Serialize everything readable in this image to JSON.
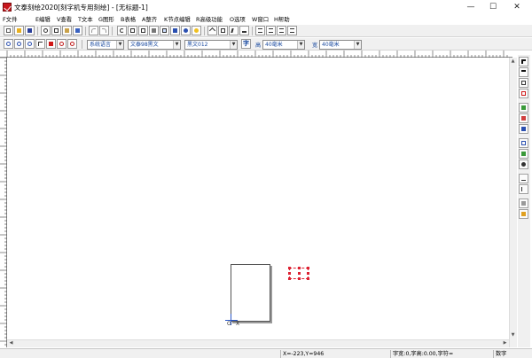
{
  "window": {
    "title": "文泰刻绘2020[刻字机专用刻绘] - [无标题-1]",
    "minimize_glyph": "—",
    "maximize_glyph": "☐",
    "close_glyph": "✕"
  },
  "menu": {
    "items": [
      "F文件",
      "E编辑",
      "V查看",
      "T文本",
      "G图形",
      "B表格",
      "A整齐",
      "K节点编辑",
      "R高级功能",
      "O选项",
      "W窗口",
      "H帮助"
    ]
  },
  "toolbar2": {
    "language": "系统语言",
    "font_chinese": "文泰98黑文",
    "font_english": "黑文012",
    "height_label": "高",
    "height_value": "40毫米",
    "width_label": "宽",
    "width_value": "40毫米",
    "format_glyph": "字"
  },
  "canvas": {
    "origin_label": "O",
    "axis_label": "X"
  },
  "status": {
    "coords": "X=-223,Y=946",
    "char_info": "字宽:0,字高:0.00,字符=",
    "mode": "数字"
  },
  "colors": {
    "accent_red": "#c8171d",
    "toolbar_blue": "#1a4aa0",
    "axis_blue": "#2a56c6"
  }
}
